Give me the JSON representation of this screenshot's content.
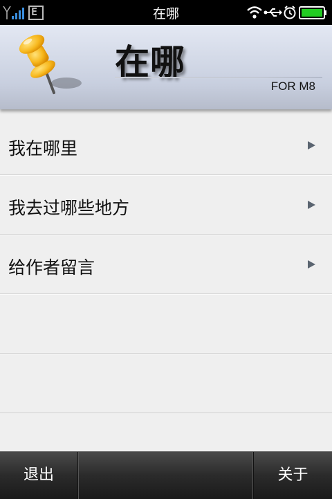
{
  "status_bar": {
    "title": "在哪",
    "network": "E",
    "left_icons": [
      "signal-icon",
      "network-type-icon"
    ],
    "right_icons": [
      "wifi-icon",
      "usb-icon",
      "alarm-icon",
      "battery-icon"
    ]
  },
  "header": {
    "title": "在哪",
    "subtitle": "FOR M8",
    "logo": "pushpin-icon"
  },
  "menu": {
    "items": [
      {
        "label": "我在哪里"
      },
      {
        "label": "我去过哪些地方"
      },
      {
        "label": "给作者留言"
      }
    ]
  },
  "bottom_bar": {
    "exit_label": "退出",
    "about_label": "关于"
  },
  "colors": {
    "status_bar": "#000000",
    "battery": "#22cc22",
    "signal": "#3a8fe0",
    "list_background": "#efefef",
    "bottom_bar": "#2b2b2b"
  }
}
